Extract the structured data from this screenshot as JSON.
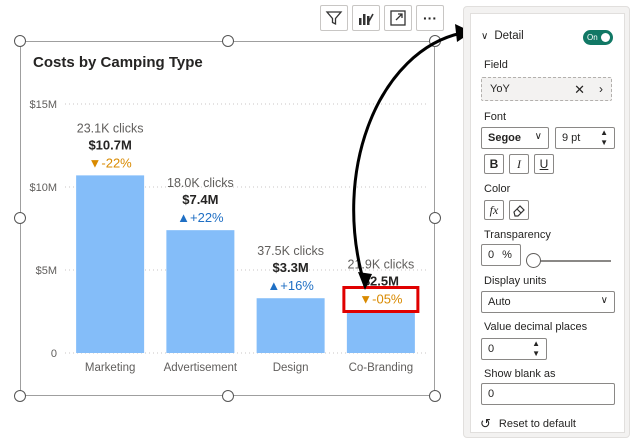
{
  "toolbar": {
    "icons": [
      "filter-icon",
      "format-icon",
      "focus-mode-icon",
      "more-options-icon"
    ],
    "more_label": "···"
  },
  "chart_data": {
    "type": "bar",
    "title": "Costs by Camping Type",
    "categories": [
      "Marketing",
      "Advertisement",
      "Design",
      "Co-Branding"
    ],
    "values": [
      10.7,
      7.4,
      3.3,
      2.5
    ],
    "unit": "$M",
    "ylim": [
      0,
      15
    ],
    "y_ticks": [
      "0",
      "$5M",
      "$10M",
      "$15M"
    ],
    "grid": true,
    "bar_color": "#84bdf9",
    "data_labels": {
      "clicks": [
        "23.1K clicks",
        "18.0K clicks",
        "37.5K clicks",
        "21.9K clicks"
      ],
      "amounts": [
        "$10.7M",
        "$7.4M",
        "$3.3M",
        "$2.5M"
      ],
      "yoy": [
        "▼-22%",
        "▲+22%",
        "▲+16%",
        "▼-05%"
      ],
      "yoy_colors": [
        "#d98a00",
        "#1f6fc4",
        "#1f6fc4",
        "#d98a00"
      ]
    },
    "highlight_category": "Co-Branding",
    "highlight_color": "#e00000"
  },
  "pane": {
    "card_title": "Detail",
    "toggle_label": "On",
    "field_label": "Field",
    "field_value": "YoY",
    "font_label": "Font",
    "font_family": "Segoe",
    "font_size": "9 pt",
    "bold": "B",
    "italic": "I",
    "underline": "U",
    "color_label": "Color",
    "fx": "fx",
    "transparency_label": "Transparency",
    "transparency_value": "0",
    "percent": "%",
    "display_units_label": "Display units",
    "display_units_value": "Auto",
    "decimal_label": "Value decimal places",
    "decimal_value": "0",
    "blank_label": "Show blank as",
    "blank_value": "0",
    "reset_label": "Reset to default"
  }
}
